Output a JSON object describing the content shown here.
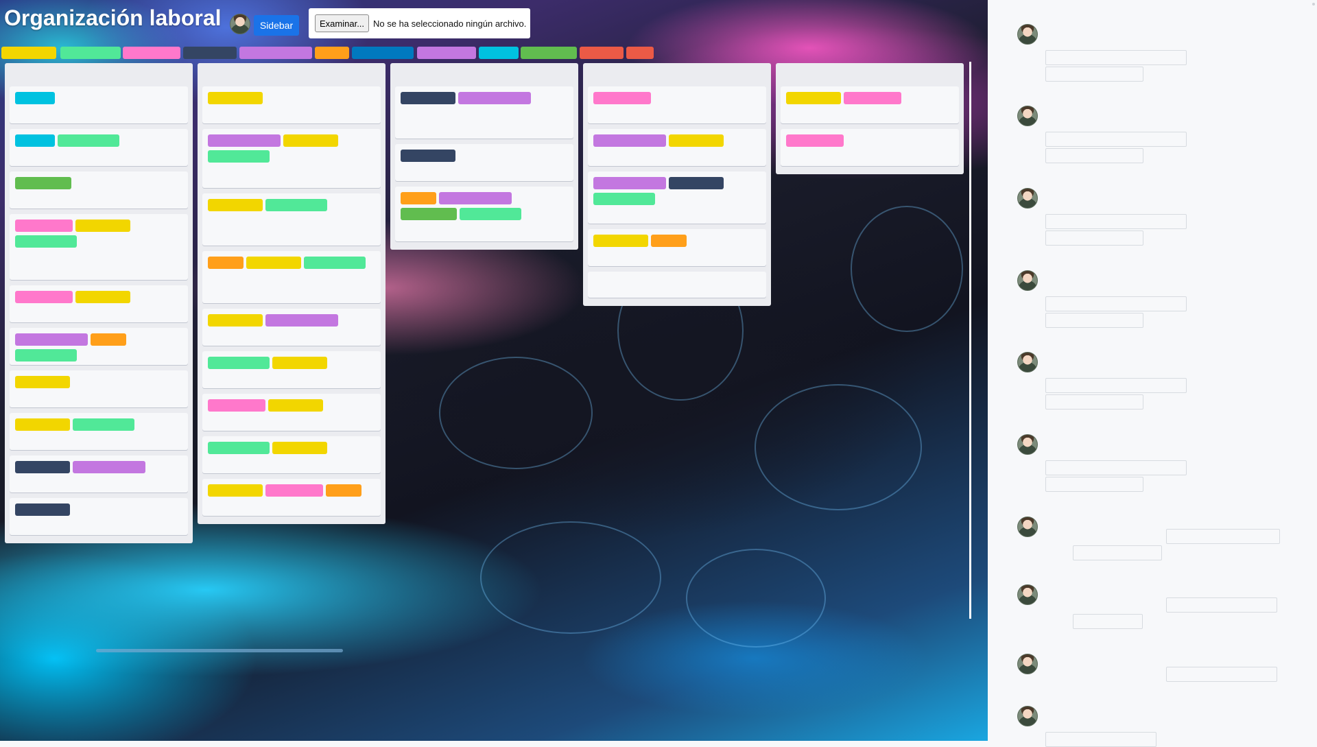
{
  "header": {
    "title": "Organización laboral",
    "sidebar_button": "Sidebar",
    "file_input": {
      "button_label": "Examinar...",
      "status": "No se ha seleccionado ningún archivo."
    }
  },
  "colors": {
    "yellow": "#f2d600",
    "green": "#51e898",
    "pink": "#ff78cb",
    "navy": "#344563",
    "purple": "#c377e0",
    "orange": "#ff9f1a",
    "blue": "#0079bf",
    "sky": "#00c2e0",
    "lime": "#61bd4f",
    "red": "#eb5a46",
    "accent": "#1a73e8"
  },
  "label_filters": [
    "yellow",
    "green",
    "pink",
    "navy",
    "purple",
    "orange",
    "blue",
    "purple",
    "sky",
    "lime",
    "red",
    "red"
  ],
  "lists": [
    {
      "cards": [
        [
          "sky"
        ],
        [
          "sky",
          "green"
        ],
        [
          "lime"
        ],
        [
          "pink",
          "yellow",
          "green"
        ],
        [
          "pink",
          "yellow"
        ],
        [
          "purple",
          "orange",
          "green"
        ],
        [
          "yellow"
        ],
        [
          "yellow",
          "green"
        ],
        [
          "navy",
          "purple"
        ],
        [
          "navy"
        ]
      ]
    },
    {
      "cards": [
        [
          "yellow"
        ],
        [
          "purple",
          "yellow",
          "green"
        ],
        [
          "yellow",
          "green"
        ],
        [
          "orange",
          "yellow",
          "green"
        ],
        [
          "yellow",
          "purple"
        ],
        [
          "green",
          "yellow"
        ],
        [
          "pink",
          "yellow"
        ],
        [
          "green",
          "yellow"
        ],
        [
          "yellow",
          "pink",
          "orange"
        ]
      ]
    },
    {
      "cards": [
        [
          "navy",
          "purple"
        ],
        [
          "navy"
        ],
        [
          "orange",
          "purple",
          "lime",
          "green"
        ]
      ]
    },
    {
      "cards": [
        [
          "pink"
        ],
        [
          "purple",
          "yellow"
        ],
        [
          "purple",
          "navy",
          "green"
        ],
        [
          "yellow",
          "orange"
        ],
        []
      ]
    },
    {
      "cards": [
        [
          "yellow",
          "pink"
        ],
        [
          "pink"
        ]
      ]
    }
  ],
  "sidebar": {
    "avatar_icon": "user-avatar-icon",
    "entries": 10
  }
}
